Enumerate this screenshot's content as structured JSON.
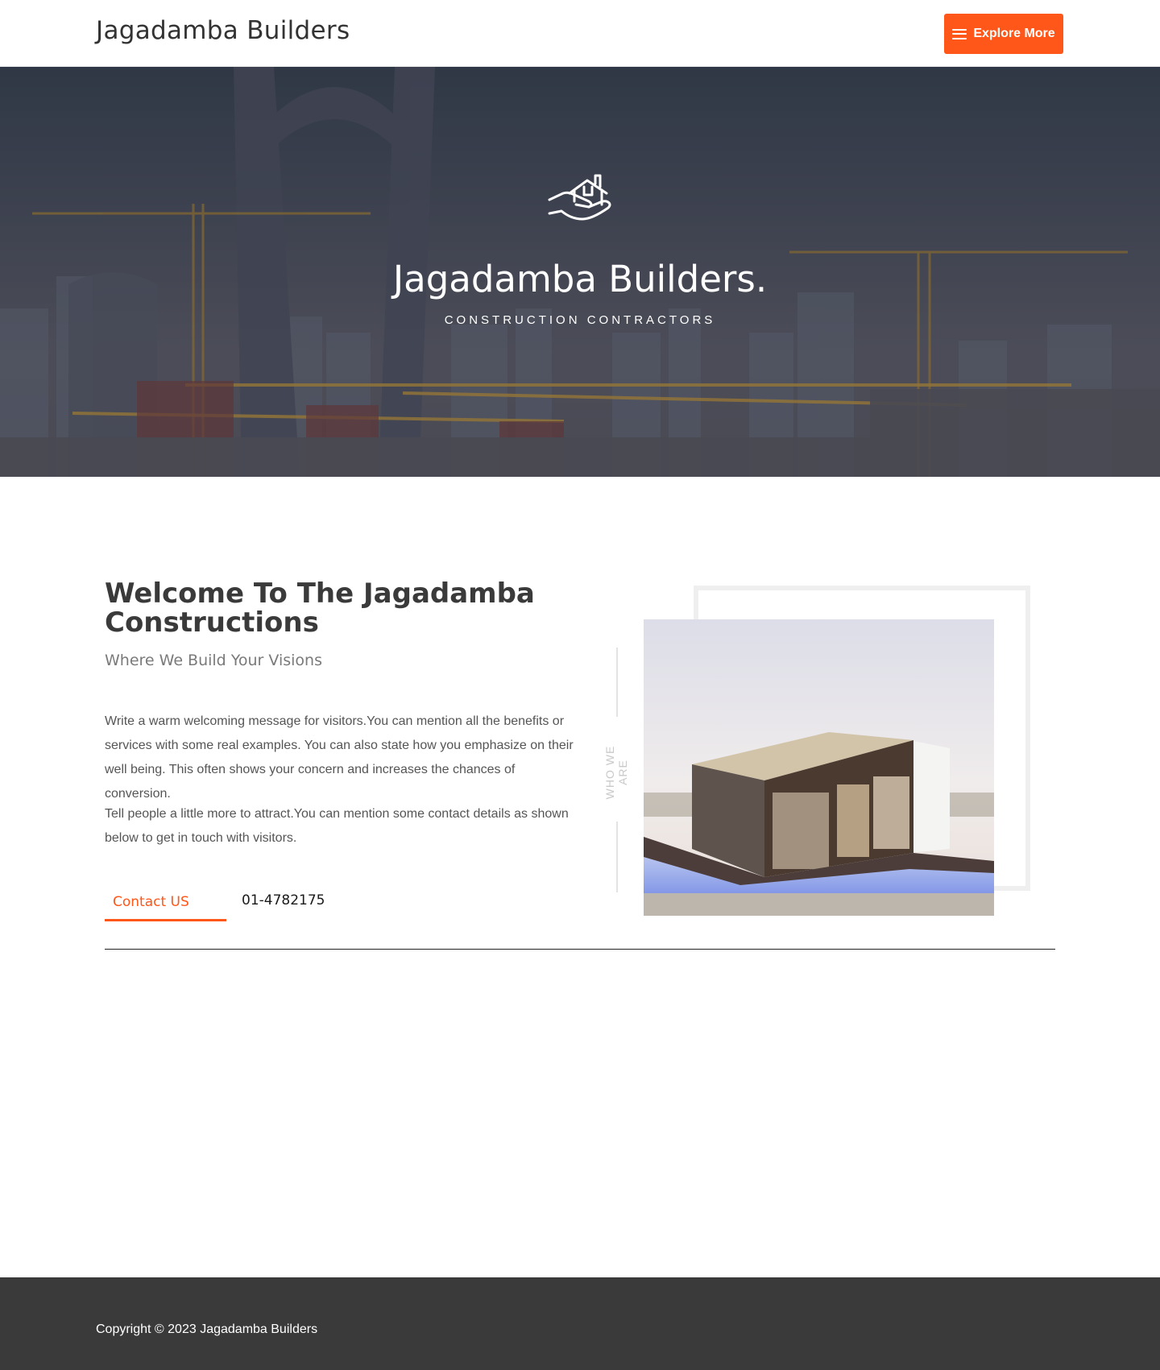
{
  "header": {
    "site_title": "Jagadamba Builders",
    "explore_label": "Explore More",
    "accent_color": "#ff5619"
  },
  "hero": {
    "icon": "hand-house-icon",
    "title": "Jagadamba Builders.",
    "subtitle": "CONSTRUCTION CONTRACTORS"
  },
  "about": {
    "heading": "Welcome To The Jagadamba Constructions",
    "subheading": "Where We Build Your Visions",
    "paragraph_1": "Write a warm welcoming message for visitors.You can mention all the benefits or services with some real examples. You can also state how you emphasize on their well being. This often shows your concern and increases the chances of conversion.",
    "paragraph_2": "Tell people a little more to attract.You can mention some contact details as shown below to get in touch with visitors.",
    "contact_label": "Contact US",
    "phone": "01-4782175",
    "vertical_label": "WHO WE ARE"
  },
  "footer": {
    "copyright": "Copyright © 2023 Jagadamba Builders"
  }
}
